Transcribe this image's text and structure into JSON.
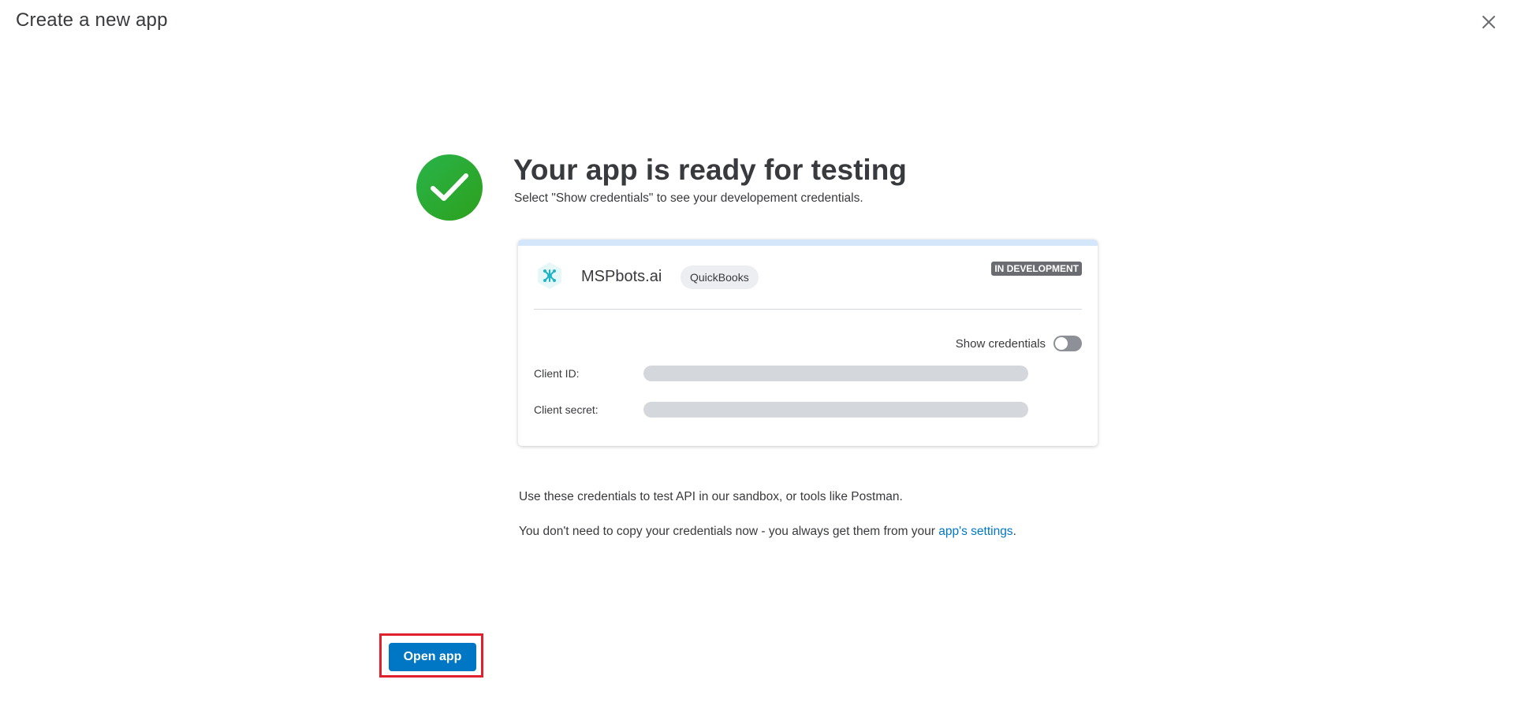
{
  "dialog": {
    "title": "Create a new app",
    "close_icon": "close-icon"
  },
  "hero": {
    "icon": "check-circle-icon",
    "icon_color": "#2ca01c",
    "title": "Your app is ready for testing",
    "subtitle": "Select \"Show credentials\" to see your developement credentials."
  },
  "card": {
    "accent_color": "#d4e6f9",
    "app_logo_icon": "app-logo-icon",
    "app_name": "MSPbots.ai",
    "app_tag": "QuickBooks",
    "status_badge": "IN DEVELOPMENT",
    "show_credentials_label": "Show credentials",
    "show_credentials_on": false,
    "client_id_label": "Client ID:",
    "client_secret_label": "Client secret:"
  },
  "info": {
    "line1": "Use these credentials to test API in our sandbox, or tools like Postman.",
    "line2_prefix": "You don't need to copy your credentials now - you always get them from your ",
    "line2_link": "app's settings",
    "line2_suffix": "."
  },
  "footer": {
    "open_app_label": "Open app",
    "button_color": "#0077c5",
    "highlight_color": "#e0202b"
  }
}
